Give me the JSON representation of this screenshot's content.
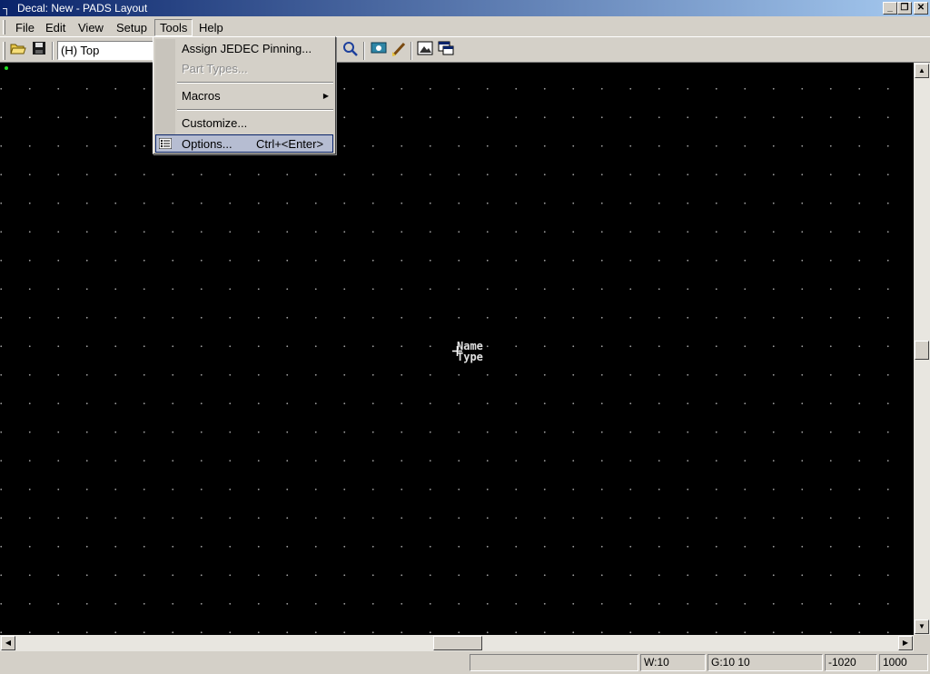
{
  "window": {
    "title": "Decal: New - PADS Layout",
    "app_icon": "pads-icon",
    "controls": [
      "minimize",
      "restore",
      "close"
    ]
  },
  "menubar": {
    "items": [
      "File",
      "Edit",
      "View",
      "Setup",
      "Tools",
      "Help"
    ],
    "open_menu": "Tools"
  },
  "toolbar": {
    "layer_combo_value": "(H) Top",
    "icons": [
      "open-icon",
      "save-icon",
      "zoom-icon",
      "view-icon",
      "brush-icon",
      "image-icon",
      "window-icon"
    ]
  },
  "tools_menu": {
    "items": [
      {
        "label": "Assign JEDEC Pinning...",
        "enabled": true
      },
      {
        "label": "Part Types...",
        "enabled": false
      },
      {
        "label": "Macros",
        "enabled": true,
        "submenu": true
      },
      {
        "label": "Customize...",
        "enabled": true
      },
      {
        "label": "Options...",
        "shortcut": "Ctrl+<Enter>",
        "enabled": true,
        "highlighted": true
      }
    ]
  },
  "canvas": {
    "labels": [
      "Name",
      "Type"
    ],
    "background": "#000000",
    "grid_color": "#9a9a9a",
    "origin_color": "#22dd22"
  },
  "statusbar": {
    "width": "W:10",
    "grid": "G:10 10",
    "x": "-1020",
    "y": "1000"
  }
}
